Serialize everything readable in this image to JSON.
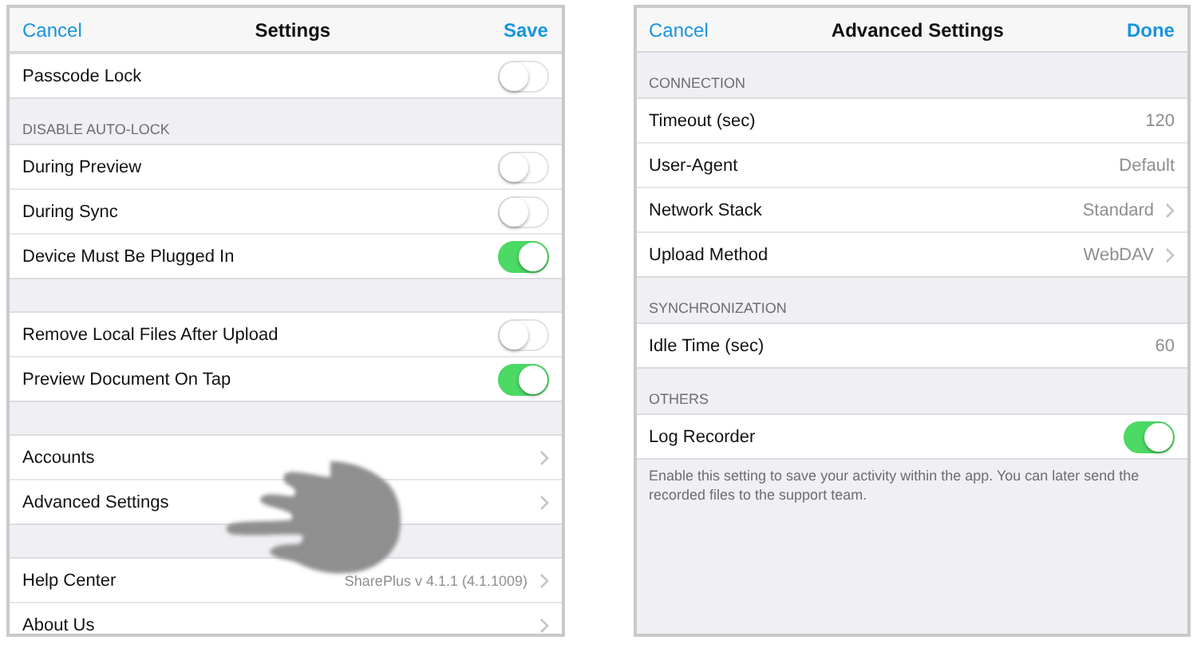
{
  "panels": [
    {
      "nav": {
        "left": "Cancel",
        "title": "Settings",
        "right": "Save"
      },
      "sections": [
        {
          "rows": [
            {
              "kind": "toggle",
              "label": "Passcode Lock",
              "on": false
            }
          ]
        },
        {
          "header": "DISABLE AUTO-LOCK",
          "rows": [
            {
              "kind": "toggle",
              "label": "During Preview",
              "on": false
            },
            {
              "kind": "toggle",
              "label": "During Sync",
              "on": false
            },
            {
              "kind": "toggle",
              "label": "Device Must Be Plugged In",
              "on": true
            }
          ]
        },
        {
          "rows": [
            {
              "kind": "toggle",
              "label": "Remove Local Files After Upload",
              "on": false
            },
            {
              "kind": "toggle",
              "label": "Preview Document On Tap",
              "on": true
            }
          ]
        },
        {
          "rows": [
            {
              "kind": "link",
              "label": "Accounts"
            },
            {
              "kind": "link",
              "label": "Advanced Settings"
            }
          ]
        },
        {
          "rows": [
            {
              "kind": "link",
              "label": "Help Center",
              "value": "SharePlus v 4.1.1 (4.1.1009)"
            },
            {
              "kind": "link",
              "label": "About Us"
            }
          ]
        }
      ],
      "gesture": true
    },
    {
      "nav": {
        "left": "Cancel",
        "title": "Advanced Settings",
        "right": "Done"
      },
      "sections": [
        {
          "header": "CONNECTION",
          "rows": [
            {
              "kind": "value",
              "label": "Timeout (sec)",
              "value": "120"
            },
            {
              "kind": "value",
              "label": "User-Agent",
              "value": "Default"
            },
            {
              "kind": "link",
              "label": "Network Stack",
              "value": "Standard"
            },
            {
              "kind": "link",
              "label": "Upload Method",
              "value": "WebDAV"
            }
          ]
        },
        {
          "header": "SYNCHRONIZATION",
          "rows": [
            {
              "kind": "value",
              "label": "Idle Time (sec)",
              "value": "60"
            }
          ]
        },
        {
          "header": "OTHERS",
          "rows": [
            {
              "kind": "toggle",
              "label": "Log Recorder",
              "on": true
            }
          ],
          "footer": "Enable this setting to save your activity within the app. You can later send the recorded files to the support team."
        }
      ],
      "gesture": false
    }
  ]
}
